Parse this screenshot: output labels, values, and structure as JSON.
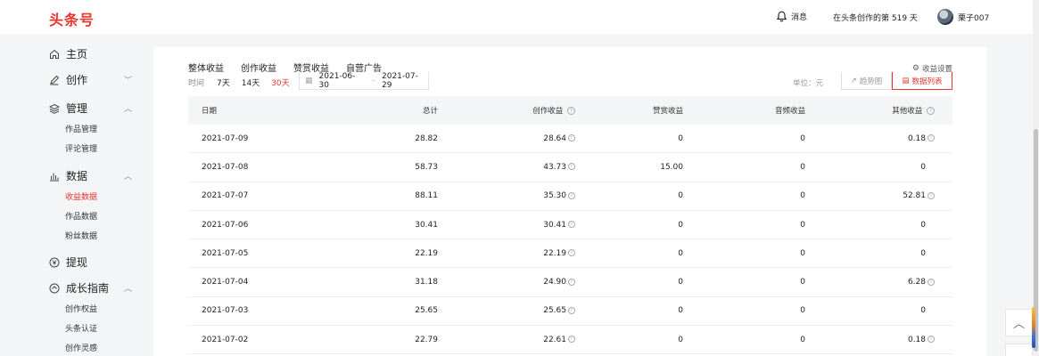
{
  "header": {
    "logo": "头条号",
    "messages_label": "消息",
    "days_text": "在头条创作的第 519 天",
    "username": "栗子007"
  },
  "sidebar": {
    "home": "主页",
    "create": "创作",
    "manage": "管理",
    "manage_items": [
      "作品管理",
      "评论管理"
    ],
    "data": "数据",
    "data_items": [
      "收益数据",
      "作品数据",
      "粉丝数据"
    ],
    "withdraw": "提现",
    "growth": "成长指南",
    "growth_items": [
      "创作权益",
      "头条认证",
      "创作灵感"
    ]
  },
  "main": {
    "tabs": [
      "整体收益",
      "创作收益",
      "赞赏收益",
      "自营广告"
    ],
    "settings_label": "收益设置",
    "filter": {
      "label": "时间",
      "ranges": [
        "7天",
        "14天",
        "30天"
      ],
      "active_range": "30天",
      "date_start": "2021-06-30",
      "date_end": "2021-07-29",
      "date_sep": "–"
    },
    "unit_label": "单位：元",
    "trend_button": "趋势图",
    "list_button": "数据列表"
  },
  "table": {
    "headers": [
      "日期",
      "总计",
      "创作收益",
      "赞赏收益",
      "音频收益",
      "其他收益"
    ],
    "rows": [
      [
        "2021-07-09",
        "28.82",
        "28.64",
        "0",
        "0",
        "0.18"
      ],
      [
        "2021-07-08",
        "58.73",
        "43.73",
        "15.00",
        "0",
        "0"
      ],
      [
        "2021-07-07",
        "88.11",
        "35.30",
        "0",
        "0",
        "52.81"
      ],
      [
        "2021-07-06",
        "30.41",
        "30.41",
        "0",
        "0",
        "0"
      ],
      [
        "2021-07-05",
        "22.19",
        "22.19",
        "0",
        "0",
        "0"
      ],
      [
        "2021-07-04",
        "31.18",
        "24.90",
        "0",
        "0",
        "6.28"
      ],
      [
        "2021-07-03",
        "25.65",
        "25.65",
        "0",
        "0",
        "0"
      ],
      [
        "2021-07-02",
        "22.79",
        "22.61",
        "0",
        "0",
        "0.18"
      ]
    ]
  },
  "colors": {
    "accent": "#e8372f",
    "background": "#f4f5f6"
  }
}
